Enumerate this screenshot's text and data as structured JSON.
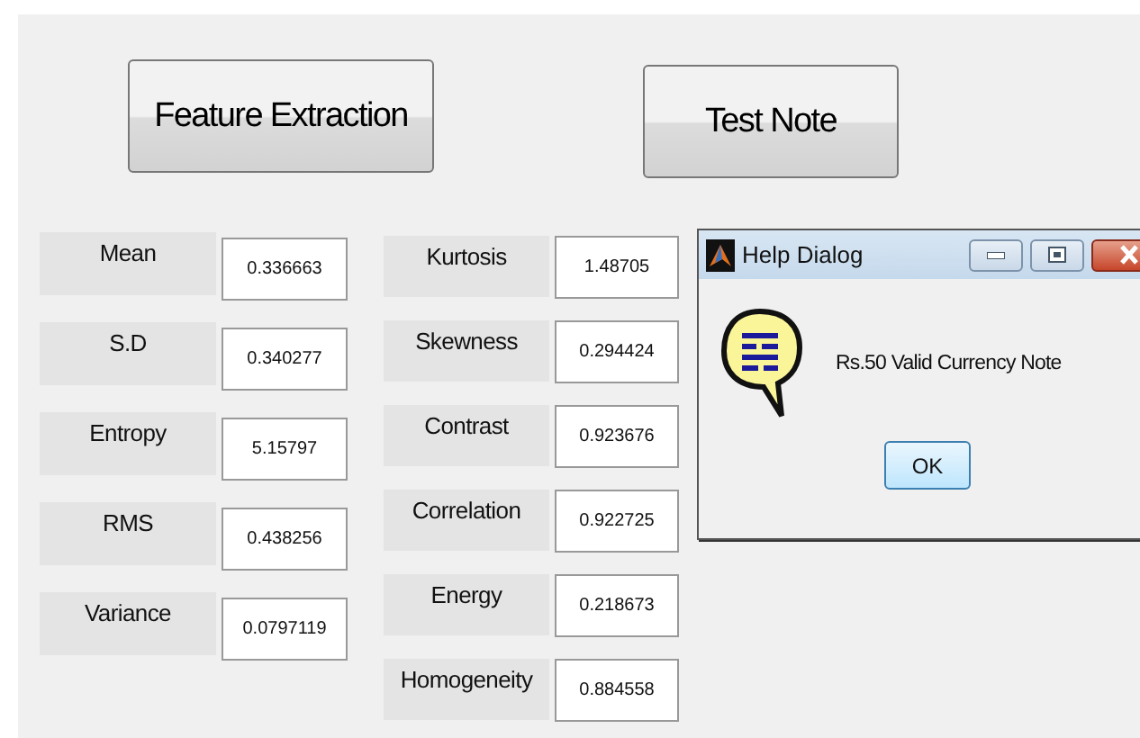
{
  "buttons": [
    {
      "label": "Feature Extraction"
    },
    {
      "label": "Test Note"
    }
  ],
  "features_left": [
    {
      "label": "Mean",
      "value": "0.336663"
    },
    {
      "label": "S.D",
      "value": "0.340277"
    },
    {
      "label": "Entropy",
      "value": "5.15797"
    },
    {
      "label": "RMS",
      "value": "0.438256"
    },
    {
      "label": "Variance",
      "value": "0.0797119"
    }
  ],
  "features_right": [
    {
      "label": "Kurtosis",
      "value": "1.48705"
    },
    {
      "label": "Skewness",
      "value": "0.294424"
    },
    {
      "label": "Contrast",
      "value": "0.923676"
    },
    {
      "label": "Correlation",
      "value": "0.922725"
    },
    {
      "label": "Energy",
      "value": "0.218673"
    },
    {
      "label": "Homogeneity",
      "value": "0.884558"
    }
  ],
  "dialog": {
    "title": "Help Dialog",
    "message": "Rs.50 Valid Currency Note",
    "button": "OK"
  }
}
